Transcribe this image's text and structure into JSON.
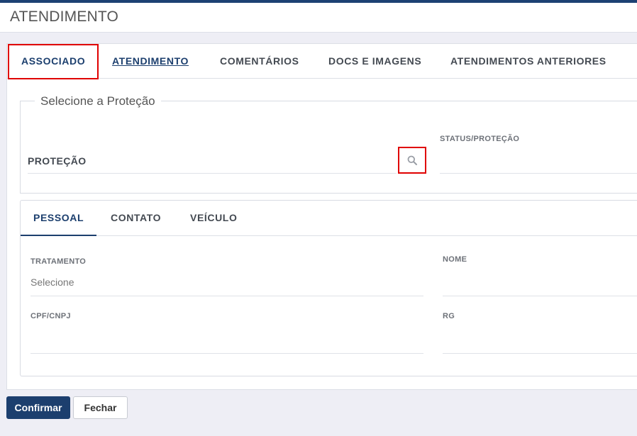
{
  "header": {
    "title": "ATENDIMENTO"
  },
  "tabs": [
    "ASSOCIADO",
    "ATENDIMENTO",
    "COMENTÁRIOS",
    "DOCS E IMAGENS",
    "ATENDIMENTOS ANTERIORES"
  ],
  "protection": {
    "legend": "Selecione a Proteção",
    "field_label": "PROTEÇÃO",
    "search_icon": "search-icon",
    "status_label": "STATUS/PROTEÇÃO",
    "status_value": ""
  },
  "subtabs": [
    "PESSOAL",
    "CONTATO",
    "VEÍCULO"
  ],
  "personal": {
    "tratamento_label": "TRATAMENTO",
    "tratamento_value": "Selecione",
    "nome_label": "NOME",
    "nome_value": "",
    "cpf_label": "CPF/CNPJ",
    "cpf_value": "",
    "rg_label": "RG",
    "rg_value": ""
  },
  "buttons": {
    "confirm": "Confirmar",
    "close": "Fechar"
  },
  "colors": {
    "accent": "#1c3f6e",
    "highlight": "#e00000"
  }
}
